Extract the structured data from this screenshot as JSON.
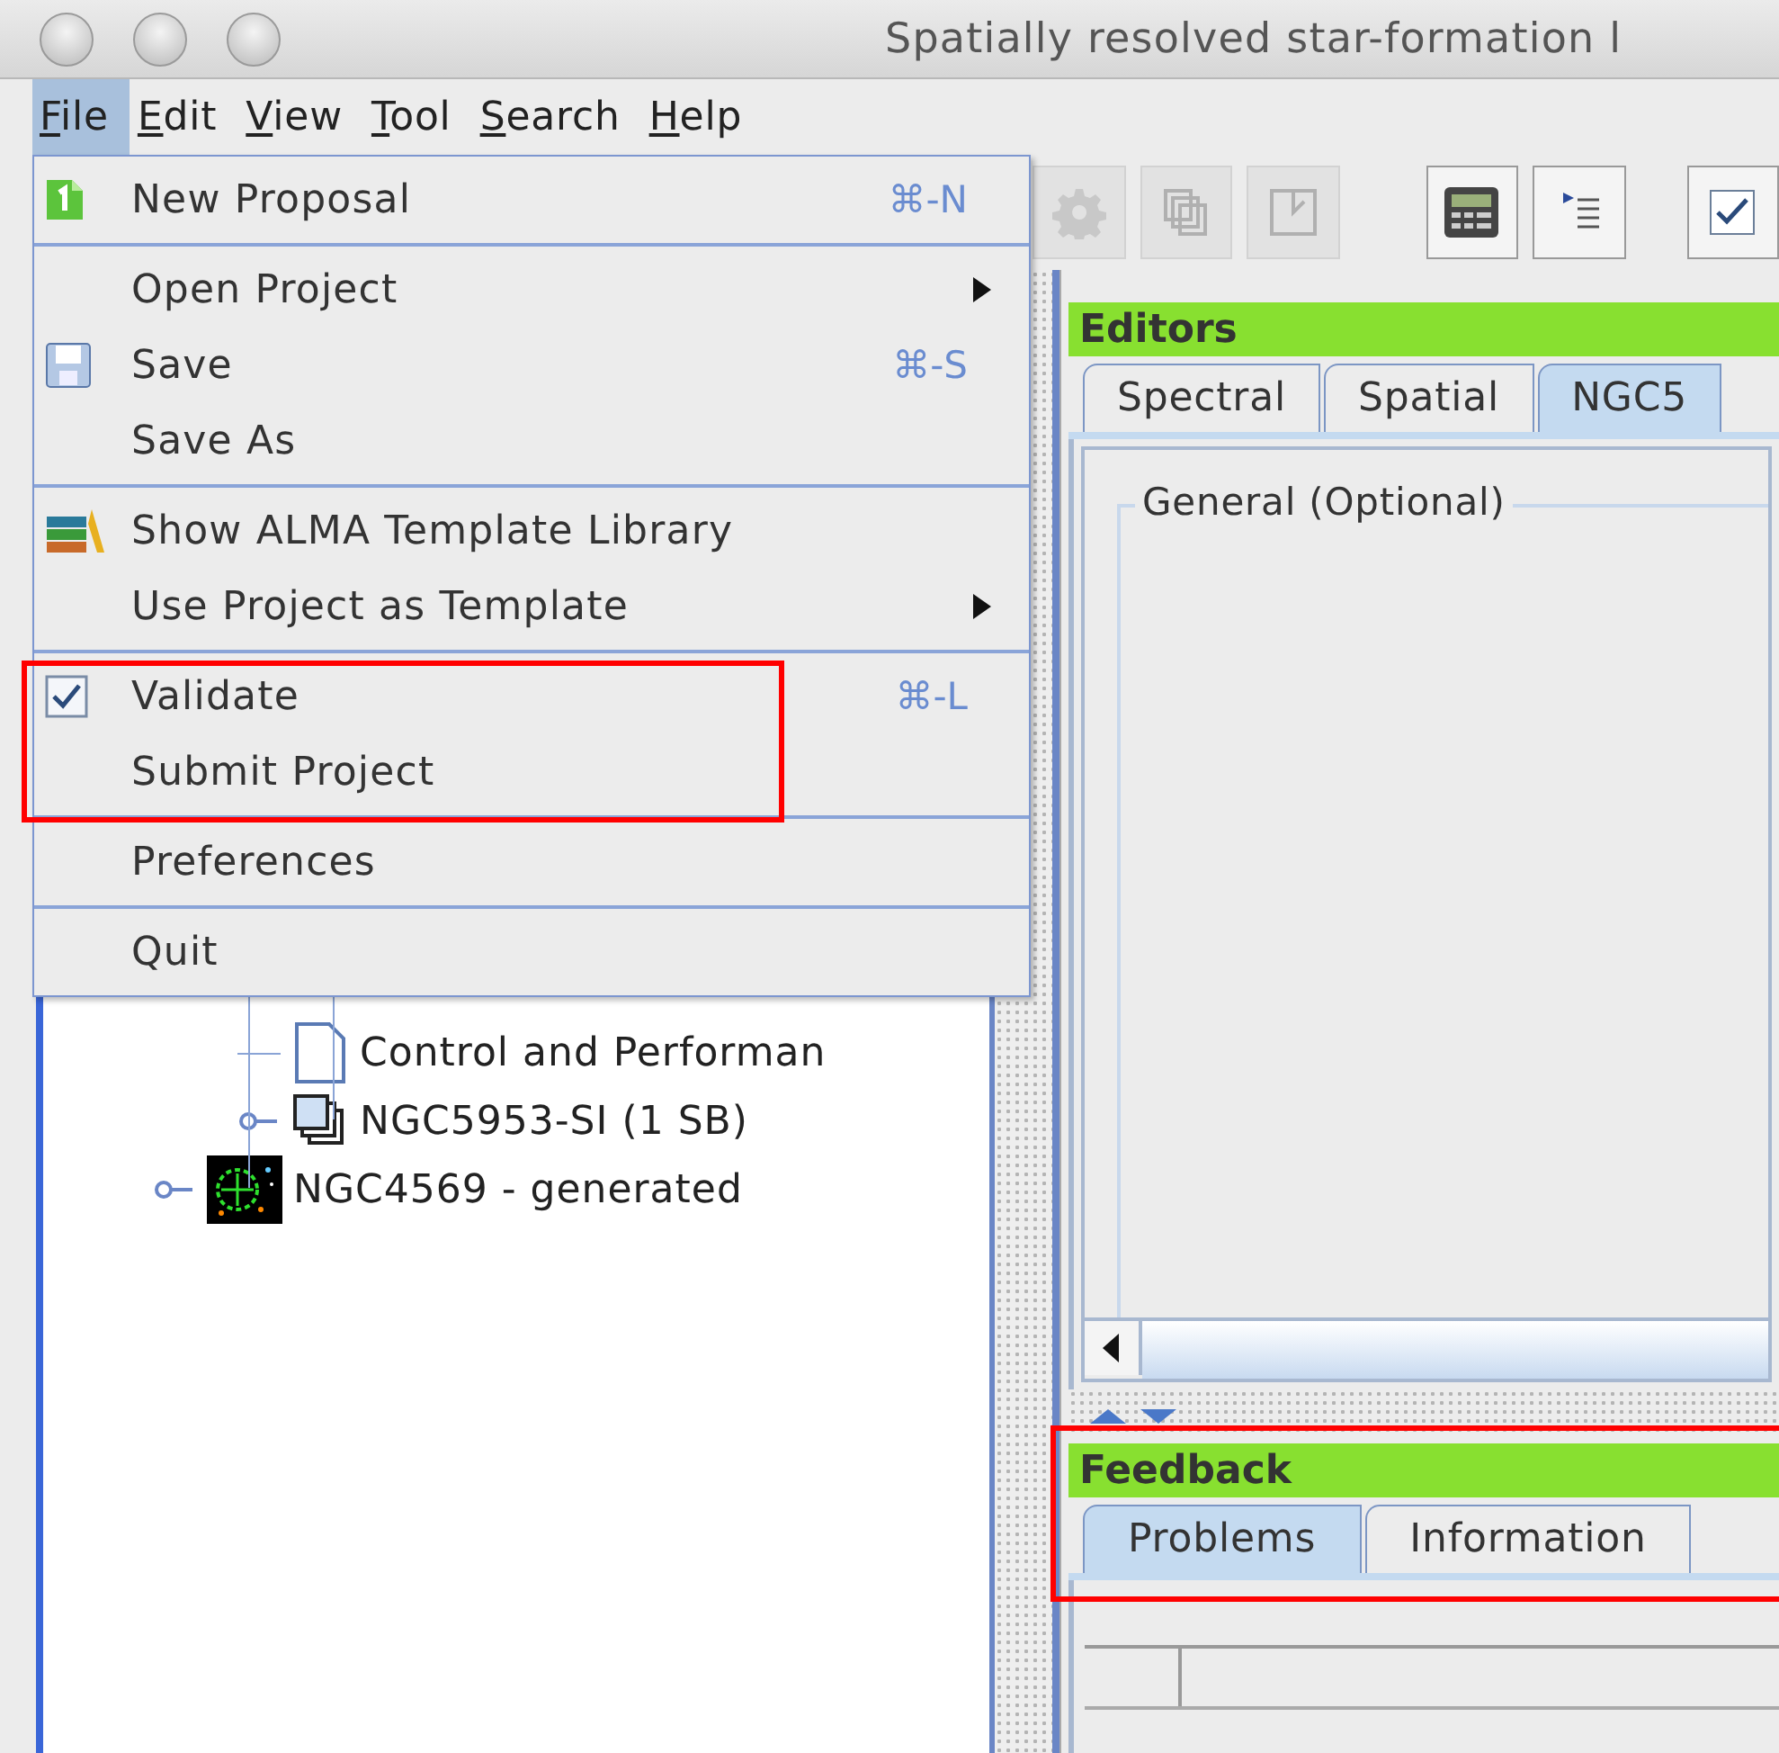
{
  "window": {
    "title": "Spatially resolved star-formation l"
  },
  "menubar": [
    {
      "label": "File",
      "selected": true
    },
    {
      "label": "Edit",
      "selected": false
    },
    {
      "label": "View",
      "selected": false
    },
    {
      "label": "Tool",
      "selected": false
    },
    {
      "label": "Search",
      "selected": false
    },
    {
      "label": "Help",
      "selected": false
    }
  ],
  "toolbar": [
    {
      "kind": "gear",
      "disabled": true
    },
    {
      "kind": "pages",
      "disabled": true
    },
    {
      "kind": "chart",
      "disabled": true
    },
    {
      "kind": "calculator",
      "disabled": false
    },
    {
      "kind": "list",
      "disabled": false
    },
    {
      "kind": "checkbox",
      "disabled": false
    }
  ],
  "file_menu": {
    "sections": [
      {
        "highlighted": false,
        "items": [
          {
            "kind": "new-document",
            "label": "New Proposal",
            "shortcut": "⌘-N"
          }
        ]
      },
      {
        "highlighted": false,
        "items": [
          {
            "kind": "submenu",
            "label": "Open Project"
          },
          {
            "kind": "save",
            "label": "Save",
            "shortcut": "⌘-S"
          },
          {
            "kind": "plain",
            "label": "Save As"
          }
        ]
      },
      {
        "highlighted": false,
        "items": [
          {
            "kind": "library",
            "label": "Show ALMA Template Library"
          },
          {
            "kind": "submenu",
            "label": "Use Project as Template"
          }
        ]
      },
      {
        "highlighted": true,
        "items": [
          {
            "kind": "checkbox",
            "label": "Validate",
            "shortcut": "⌘-L",
            "checked": true
          },
          {
            "kind": "plain",
            "label": "Submit Project"
          }
        ]
      },
      {
        "highlighted": false,
        "items": [
          {
            "kind": "plain",
            "label": "Preferences"
          }
        ]
      },
      {
        "highlighted": false,
        "items": [
          {
            "kind": "plain",
            "label": "Quit"
          }
        ]
      }
    ]
  },
  "tree": [
    {
      "children": [
        {
          "label": "Control and Performan",
          "kind": "document"
        },
        {
          "label": "NGC5953-SI (1 SB)",
          "kind": "scheduling-block",
          "expanded": false
        }
      ]
    },
    {
      "label": "NGC4569 - generated",
      "kind": "target",
      "expanded": false
    }
  ],
  "editors": {
    "title": "Editors",
    "tabs": [
      {
        "label": "Spectral",
        "selected": false
      },
      {
        "label": "Spatial",
        "selected": false
      },
      {
        "label": "NGC5",
        "selected": true
      }
    ],
    "group_title": "General (Optional)"
  },
  "feedback": {
    "title": "Feedback",
    "highlighted": true,
    "tabs": [
      {
        "label": "Problems",
        "selected": true
      },
      {
        "label": "Information",
        "selected": false
      }
    ]
  }
}
